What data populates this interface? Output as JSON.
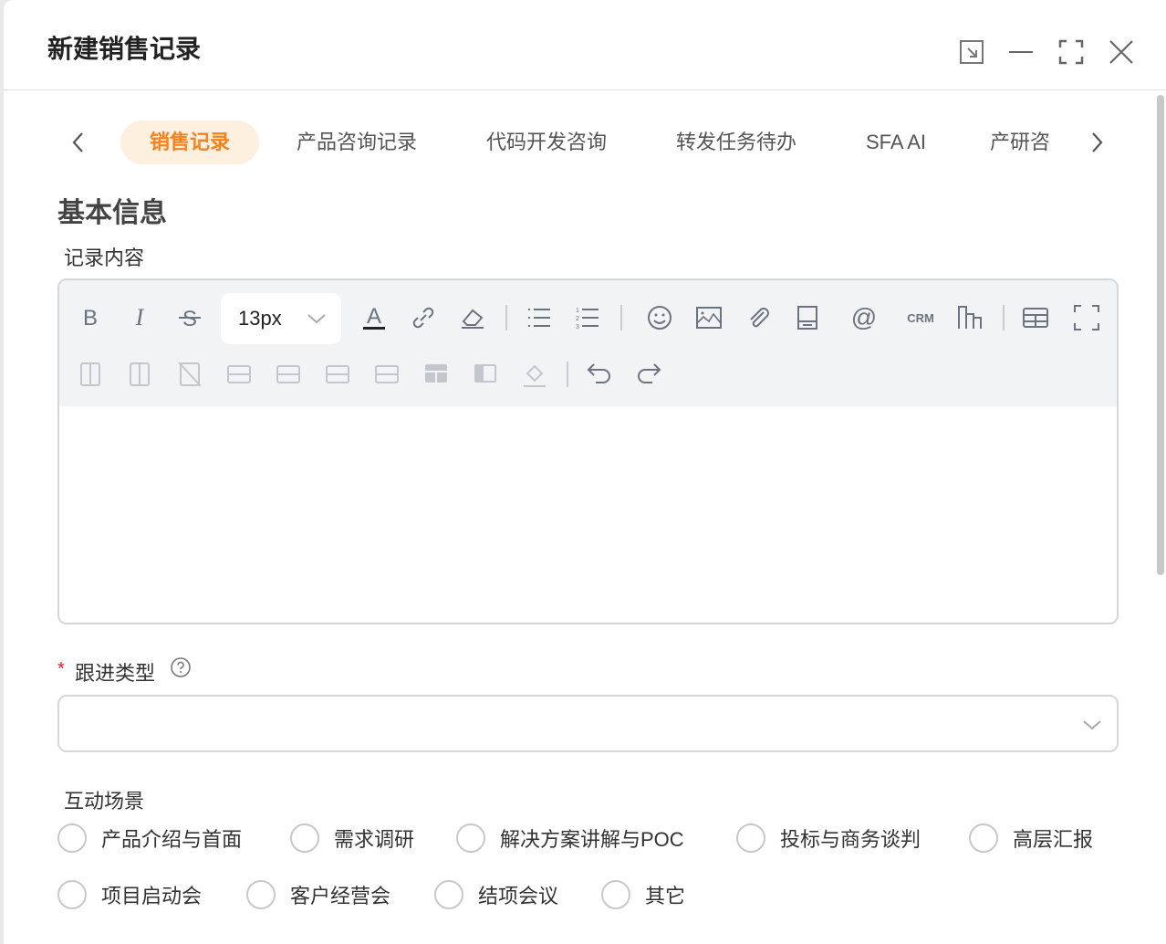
{
  "dialog": {
    "title": "新建销售记录"
  },
  "tabs": [
    {
      "label": "销售记录",
      "active": true
    },
    {
      "label": "产品咨询记录"
    },
    {
      "label": "代码开发咨询"
    },
    {
      "label": "转发任务待办"
    },
    {
      "label": "SFA AI"
    },
    {
      "label": "产研咨"
    }
  ],
  "section": {
    "title": "基本信息"
  },
  "record": {
    "label": "记录内容",
    "font_size": "13px",
    "crm_label": "CRM"
  },
  "follow": {
    "required_mark": "*",
    "label": "跟进类型",
    "value": ""
  },
  "scene": {
    "label": "互动场景",
    "options": [
      "产品介绍与首面",
      "需求调研",
      "解决方案讲解与POC",
      "投标与商务谈判",
      "高层汇报",
      "项目启动会",
      "客户经营会",
      "结项会议",
      "其它"
    ]
  },
  "colors": {
    "accent": "#f5821f",
    "accent_bg": "#fdf0df",
    "required": "#e02020",
    "toolbar_bg": "#f2f3f5"
  }
}
